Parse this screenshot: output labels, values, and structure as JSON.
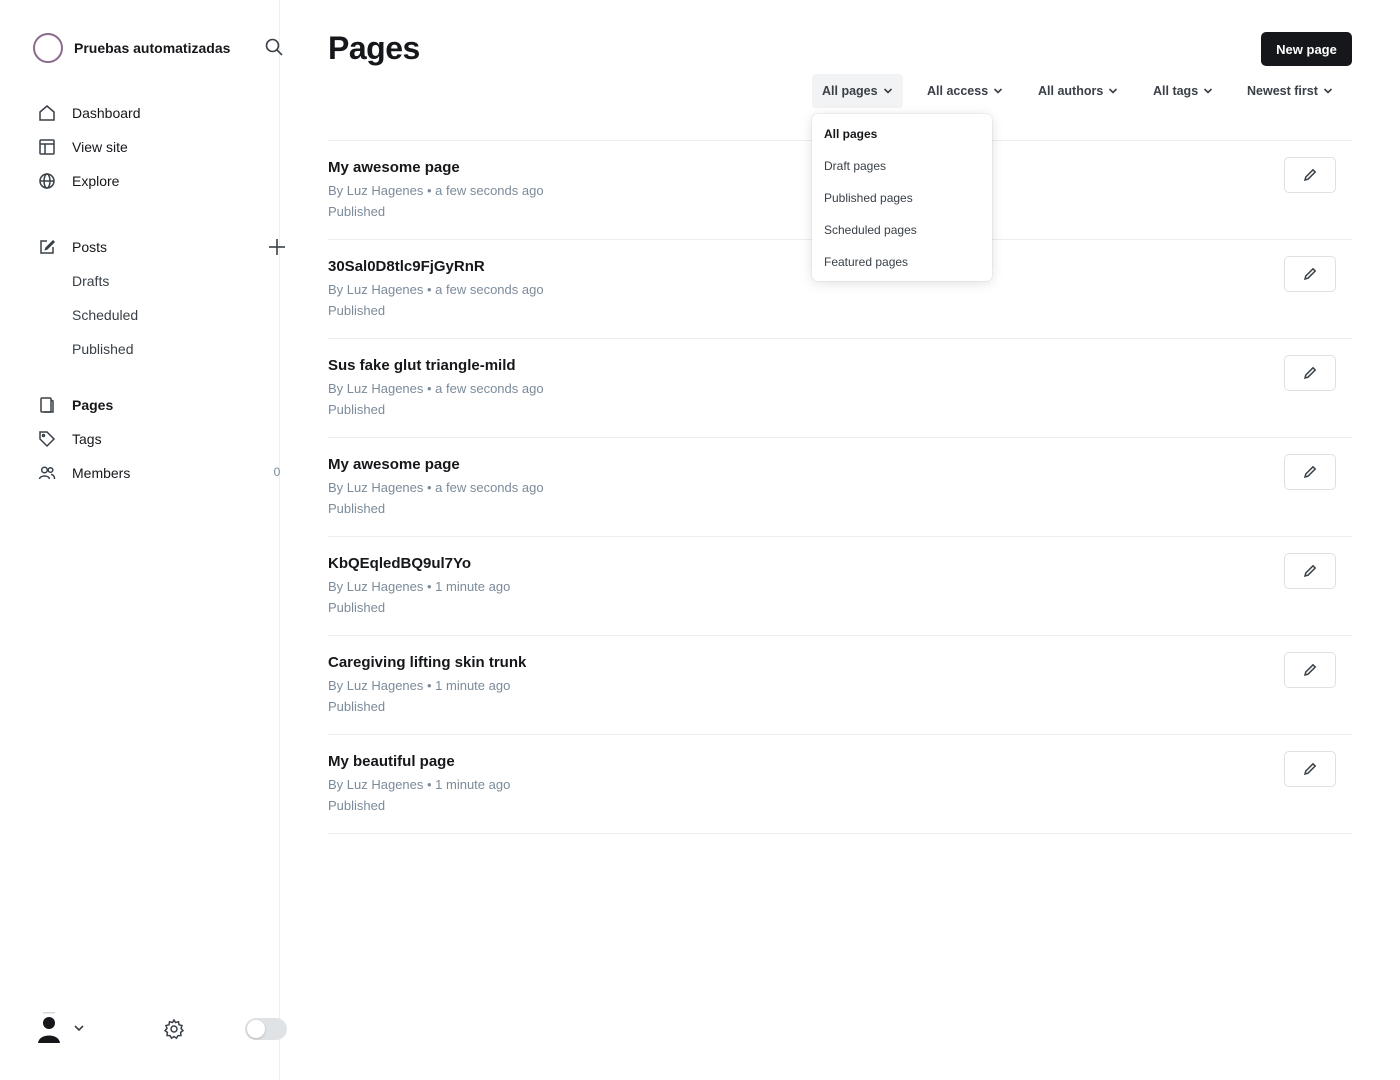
{
  "brand": {
    "name": "Pruebas automatizadas"
  },
  "nav": {
    "dashboard": "Dashboard",
    "view_site": "View site",
    "explore": "Explore",
    "posts": "Posts",
    "drafts": "Drafts",
    "scheduled": "Scheduled",
    "published": "Published",
    "pages": "Pages",
    "tags": "Tags",
    "members": "Members",
    "members_count": "0"
  },
  "header": {
    "title": "Pages",
    "new_button": "New page"
  },
  "filters": {
    "type": "All pages",
    "access": "All access",
    "authors": "All authors",
    "tags": "All tags",
    "sort": "Newest first"
  },
  "type_dropdown": {
    "options": [
      "All pages",
      "Draft pages",
      "Published pages",
      "Scheduled pages",
      "Featured pages"
    ],
    "selected": "All pages"
  },
  "pages": [
    {
      "title": "My awesome page",
      "meta": "By Luz Hagenes • a few seconds ago",
      "status": "Published"
    },
    {
      "title": "30Sal0D8tlc9FjGyRnR",
      "meta": "By Luz Hagenes • a few seconds ago",
      "status": "Published"
    },
    {
      "title": "Sus fake glut triangle-mild",
      "meta": "By Luz Hagenes • a few seconds ago",
      "status": "Published"
    },
    {
      "title": "My awesome page",
      "meta": "By Luz Hagenes • a few seconds ago",
      "status": "Published"
    },
    {
      "title": "KbQEqledBQ9ul7Yo",
      "meta": "By Luz Hagenes • 1 minute ago",
      "status": "Published"
    },
    {
      "title": "Caregiving lifting skin trunk",
      "meta": "By Luz Hagenes • 1 minute ago",
      "status": "Published"
    },
    {
      "title": "My beautiful page",
      "meta": "By Luz Hagenes • 1 minute ago",
      "status": "Published"
    }
  ]
}
